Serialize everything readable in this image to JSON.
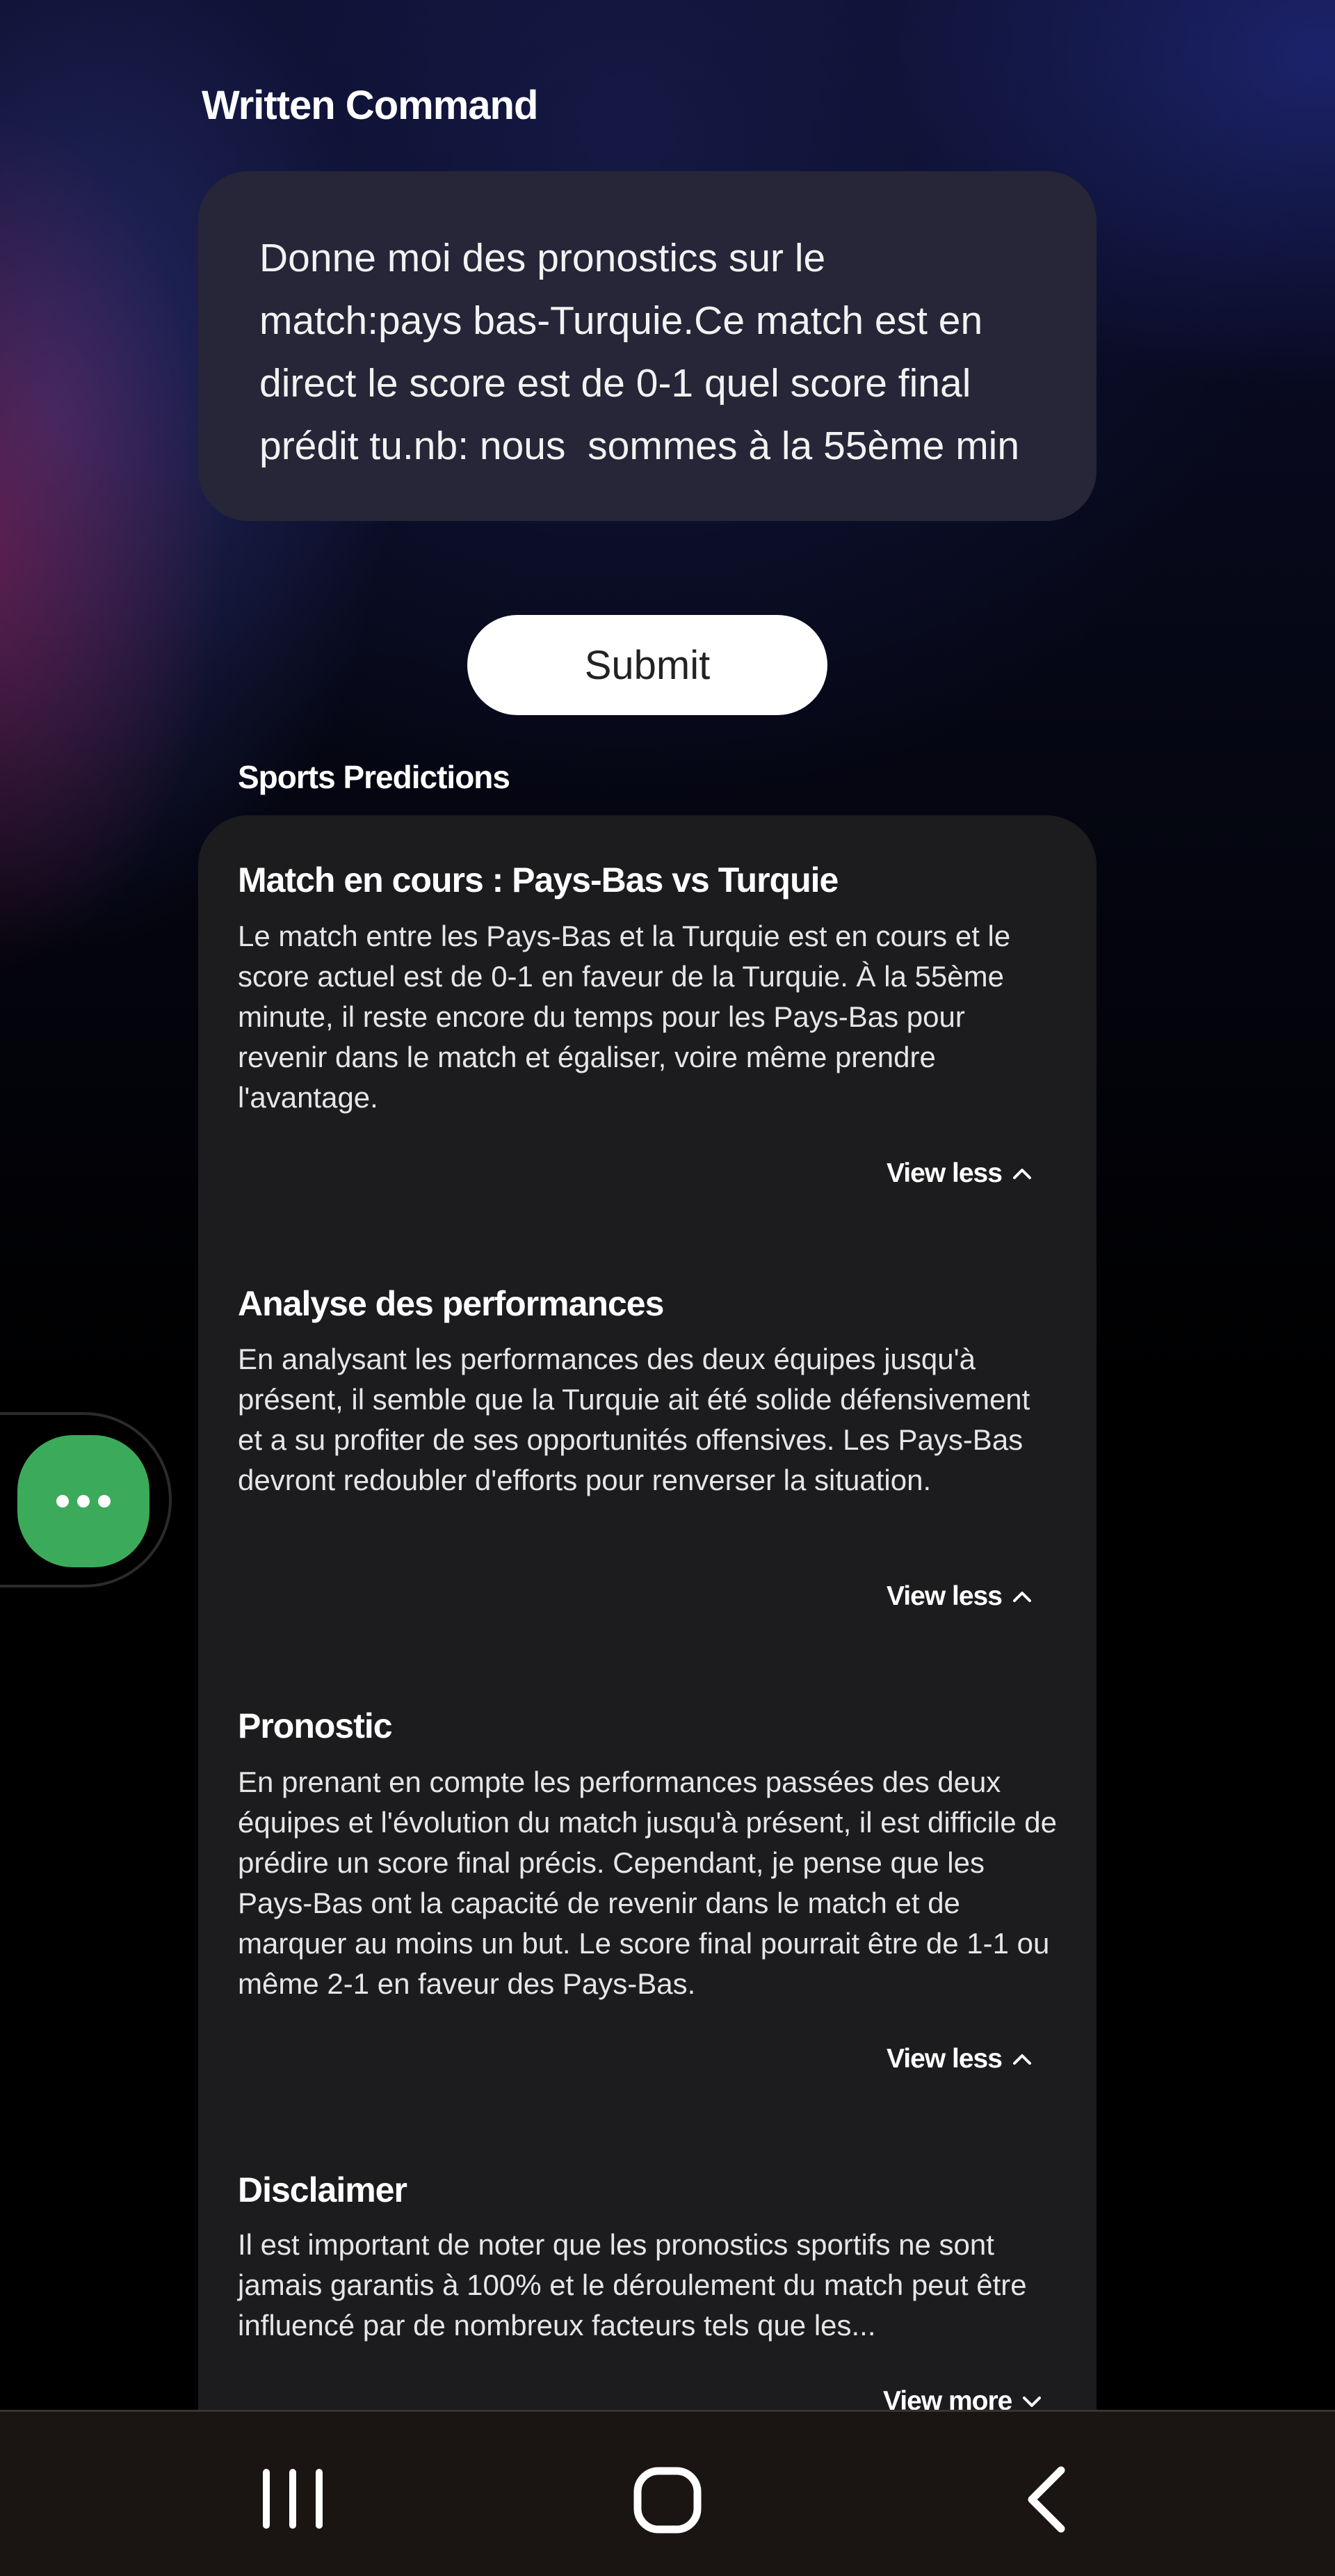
{
  "written_command": {
    "title": "Written Command",
    "text": "Donne moi des pronostics sur le\nmatch:pays bas-Turquie.Ce match est en\ndirect le score est de 0-1 quel score final\nprédit tu.nb: nous  sommes à la 55ème min"
  },
  "submit_label": "Submit",
  "sports_predictions": {
    "title": "Sports Predictions",
    "items": [
      {
        "heading": "Match en cours : Pays-Bas vs Turquie",
        "body": "Le match entre les Pays-Bas et la Turquie est en cours et le score actuel est de 0-1 en faveur de la Turquie. À la 55ème minute, il reste encore du temps pour les Pays-Bas pour revenir dans le match et égaliser, voire même prendre l'avantage.",
        "toggle": "View less"
      },
      {
        "heading": "Analyse des performances",
        "body": "En analysant les performances des deux équipes jusqu'à présent, il semble que la Turquie ait été solide défensivement et a su profiter de ses opportunités offensives. Les Pays-Bas devront redoubler d'efforts pour renverser la situation.",
        "toggle": "View less"
      },
      {
        "heading": "Pronostic",
        "body": "En prenant en compte les performances passées des deux équipes et l'évolution du match jusqu'à présent, il est difficile de prédire un score final précis. Cependant, je pense que les Pays-Bas ont la capacité de revenir dans le match et de marquer au moins un but. Le score final pourrait être de 1-1 ou même 2-1 en faveur des Pays-Bas.",
        "toggle": "View less"
      },
      {
        "heading": "Disclaimer",
        "body": "Il est important de noter que les pronostics sportifs ne sont jamais garantis à 100% et le déroulement du match peut être influencé par de nombreux facteurs tels que les...",
        "toggle": "View more"
      }
    ]
  },
  "icons": {
    "fab": "more-dots-icon",
    "nav_recent": "recent-apps-icon",
    "nav_home": "home-icon",
    "nav_back": "back-icon"
  },
  "colors": {
    "fab_green": "#3caa5b",
    "card_bg": "#1c1c1f",
    "command_bg": "#262638"
  }
}
